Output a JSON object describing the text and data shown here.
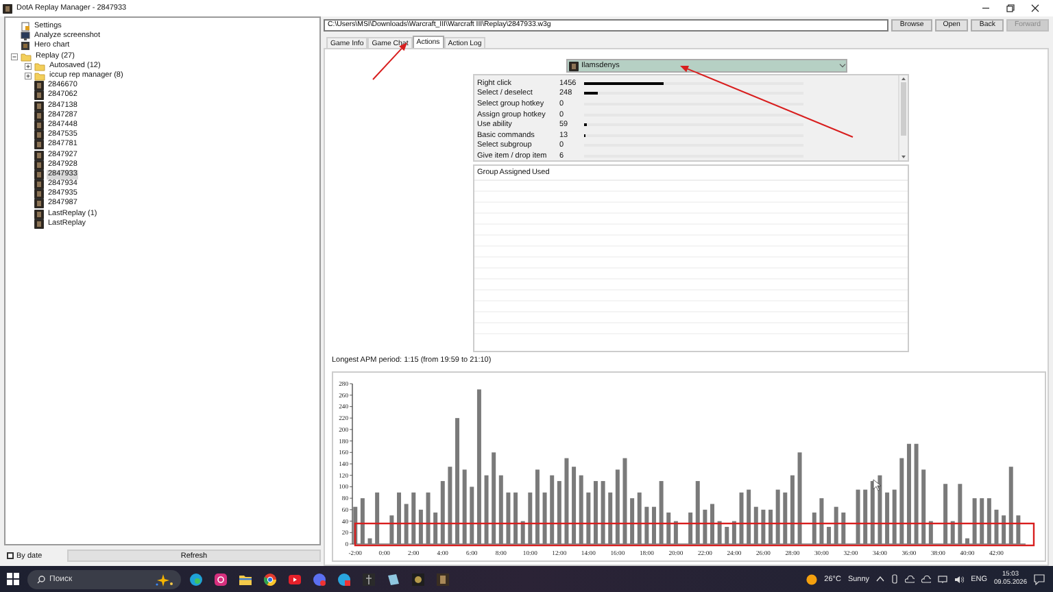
{
  "window": {
    "title": "DotA Replay Manager - 2847933"
  },
  "tree": [
    {
      "label": "Settings",
      "kind": "settings",
      "selected": false
    },
    {
      "label": "Analyze screenshot",
      "kind": "screenshot",
      "selected": false
    },
    {
      "label": "Hero chart",
      "kind": "chart",
      "selected": false
    },
    {
      "label": "Replay (27)",
      "kind": "folder",
      "selected": false,
      "expanded": true,
      "children": [
        {
          "label": "Autosaved (12)",
          "kind": "folder",
          "selected": false,
          "expanded": false
        },
        {
          "label": "iccup rep manager (8)",
          "kind": "folder",
          "selected": false,
          "expanded": false
        },
        {
          "label": "2846670",
          "kind": "replay",
          "selected": false
        },
        {
          "label": "2847062",
          "kind": "replay",
          "selected": false
        },
        {
          "label": "2847138",
          "kind": "replay",
          "selected": false
        },
        {
          "label": "2847287",
          "kind": "replay",
          "selected": false
        },
        {
          "label": "2847448",
          "kind": "replay",
          "selected": false
        },
        {
          "label": "2847535",
          "kind": "replay",
          "selected": false
        },
        {
          "label": "2847781",
          "kind": "replay",
          "selected": false
        },
        {
          "label": "2847927",
          "kind": "replay",
          "selected": false
        },
        {
          "label": "2847928",
          "kind": "replay",
          "selected": false
        },
        {
          "label": "2847933",
          "kind": "replay",
          "selected": true
        },
        {
          "label": "2847934",
          "kind": "replay",
          "selected": false
        },
        {
          "label": "2847935",
          "kind": "replay",
          "selected": false
        },
        {
          "label": "2847987",
          "kind": "replay",
          "selected": false
        },
        {
          "label": "LastReplay (1)",
          "kind": "replay",
          "selected": false
        },
        {
          "label": "LastReplay",
          "kind": "replay",
          "selected": false
        }
      ]
    }
  ],
  "by_date": {
    "label": "By date",
    "checked": false
  },
  "refresh_button": "Refresh",
  "path": {
    "value": "C:\\Users\\MSI\\Downloads\\Warcraft_III\\Warcraft III\\Replay\\2847933.w3g"
  },
  "buttons": [
    {
      "label": "Browse",
      "disabled": false
    },
    {
      "label": "Open",
      "disabled": false
    },
    {
      "label": "Back",
      "disabled": false
    },
    {
      "label": "Forward",
      "disabled": true
    }
  ],
  "tabs": [
    {
      "label": "Game Info",
      "selected": false
    },
    {
      "label": "Game Chat",
      "selected": false
    },
    {
      "label": "Actions",
      "selected": true
    },
    {
      "label": "Action Log",
      "selected": false
    }
  ],
  "player": {
    "name": "Ilamsdenys"
  },
  "actions": [
    {
      "name": "Right click",
      "count": "1456",
      "level": 0.36
    },
    {
      "name": "Select / deselect",
      "count": "248",
      "level": 0.06
    },
    {
      "name": "Select group hotkey",
      "count": "0",
      "level": 0
    },
    {
      "name": "Assign group hotkey",
      "count": "0",
      "level": 0
    },
    {
      "name": "Use ability",
      "count": "59",
      "level": 0.014
    },
    {
      "name": "Basic commands",
      "count": "13",
      "level": 0.005
    },
    {
      "name": "Select subgroup",
      "count": "0",
      "level": 0
    },
    {
      "name": "Give item / drop item",
      "count": "6",
      "level": 0
    }
  ],
  "group_table": {
    "columns": [
      "Group",
      "Assigned",
      "Used"
    ]
  },
  "longest_apm": "Longest APM period: 1:15 (from 19:59 to 21:10)",
  "chart": {
    "chart_data": {
      "type": "bar",
      "xlim": [
        -2.2,
        44
      ],
      "ylim": [
        0,
        280
      ],
      "x": [
        -2,
        -1.5,
        -1,
        -0.5,
        0.5,
        1,
        1.5,
        2,
        2.5,
        3,
        3.5,
        4,
        4.5,
        5,
        5.5,
        6,
        6.5,
        7,
        7.5,
        8,
        8.5,
        9,
        9.5,
        10,
        10.5,
        11,
        11.5,
        12,
        12.5,
        13,
        13.5,
        14,
        14.5,
        15,
        15.5,
        16,
        16.5,
        17,
        17.5,
        18,
        18.5,
        19,
        19.5,
        20,
        21,
        21.5,
        22,
        22.5,
        23,
        23.5,
        24,
        24.5,
        25,
        25.5,
        26,
        26.5,
        27,
        27.5,
        28,
        28.5,
        29.5,
        30,
        30.5,
        31,
        31.5,
        32.5,
        33,
        33.5,
        34,
        34.5,
        35,
        35.5,
        36,
        36.5,
        37,
        37.5,
        38.5,
        39,
        39.5,
        40,
        40.5,
        41,
        41.5,
        42,
        42.5,
        43,
        43.5
      ],
      "series": [
        {
          "color": "#7a7a7a",
          "values": [
            65,
            80,
            10,
            90,
            50,
            90,
            70,
            90,
            60,
            90,
            55,
            110,
            135,
            220,
            130,
            100,
            270,
            120,
            160,
            120,
            90,
            90,
            40,
            90,
            130,
            90,
            120,
            110,
            150,
            135,
            120,
            90,
            110,
            110,
            90,
            130,
            150,
            80,
            90,
            65,
            65,
            110,
            55,
            40,
            55,
            110,
            60,
            70,
            40,
            30,
            40,
            90,
            95,
            65,
            60,
            60,
            95,
            90,
            120,
            160,
            55,
            80,
            30,
            65,
            55,
            95,
            95,
            110,
            120,
            90,
            95,
            150,
            175,
            175,
            130,
            40,
            105,
            40,
            105,
            10,
            80,
            80,
            80,
            60,
            50,
            135,
            50
          ]
        }
      ],
      "yticks": [
        0,
        20,
        40,
        60,
        80,
        100,
        120,
        140,
        160,
        180,
        200,
        220,
        240,
        260,
        280
      ],
      "xticks": [
        {
          "value": -2,
          "label": "-2:00"
        },
        {
          "value": 0,
          "label": "0:00"
        },
        {
          "value": 2,
          "label": "2:00"
        },
        {
          "value": 4,
          "label": "4:00"
        },
        {
          "value": 6,
          "label": "6:00"
        },
        {
          "value": 8,
          "label": "8:00"
        },
        {
          "value": 10,
          "label": "10:00"
        },
        {
          "value": 12,
          "label": "12:00"
        },
        {
          "value": 14,
          "label": "14:00"
        },
        {
          "value": 16,
          "label": "16:00"
        },
        {
          "value": 18,
          "label": "18:00"
        },
        {
          "value": 20,
          "label": "20:00"
        },
        {
          "value": 22,
          "label": "22:00"
        },
        {
          "value": 24,
          "label": "24:00"
        },
        {
          "value": 26,
          "label": "26:00"
        },
        {
          "value": 28,
          "label": "28:00"
        },
        {
          "value": 30,
          "label": "30:00"
        },
        {
          "value": 32,
          "label": "32:00"
        },
        {
          "value": 34,
          "label": "34:00"
        },
        {
          "value": 36,
          "label": "36:00"
        },
        {
          "value": 38,
          "label": "38:00"
        },
        {
          "value": 40,
          "label": "40:00"
        },
        {
          "value": 42,
          "label": "42:00"
        }
      ]
    }
  },
  "taskbar": {
    "search": {
      "placeholder": "Поиск"
    },
    "weather": {
      "temperature": "26°C",
      "condition": "Sunny"
    },
    "language": "ENG",
    "time": "15:03",
    "date": "09.05.2026"
  }
}
